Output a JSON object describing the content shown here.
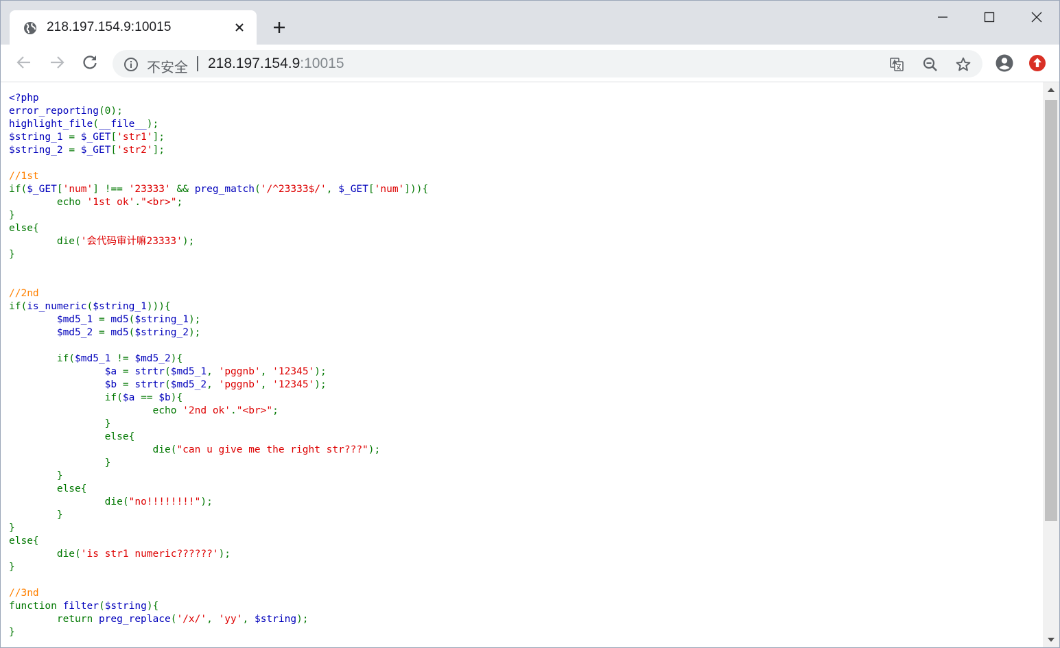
{
  "tab": {
    "title": "218.197.154.9:10015"
  },
  "omnibox": {
    "security_label": "不安全",
    "url_host": "218.197.154.9",
    "url_port": ":10015"
  },
  "icons": {
    "tab_favicon": "globe-icon",
    "tab_close": "close-icon",
    "new_tab": "plus-icon",
    "back": "back-arrow-icon",
    "forward": "forward-arrow-icon",
    "reload": "reload-icon",
    "site_info": "info-icon",
    "translate": "translate-icon",
    "zoom": "zoom-out-icon",
    "bookmark": "star-icon",
    "profile": "account-icon",
    "update": "update-icon"
  },
  "colors": {
    "php_default": "#0000bb",
    "php_keyword": "#007700",
    "php_string": "#dd0000",
    "php_comment": "#ff8000",
    "update_badge": "#d93025"
  },
  "code_lines": [
    [
      [
        "d",
        "<?php"
      ]
    ],
    [
      [
        "d",
        "error_reporting"
      ],
      [
        "k",
        "(0);"
      ]
    ],
    [
      [
        "d",
        "highlight_file"
      ],
      [
        "k",
        "("
      ],
      [
        "d",
        "__file__"
      ],
      [
        "k",
        ");"
      ]
    ],
    [
      [
        "d",
        "$string_1 "
      ],
      [
        "k",
        "= "
      ],
      [
        "d",
        "$_GET"
      ],
      [
        "k",
        "["
      ],
      [
        "s",
        "'str1'"
      ],
      [
        "k",
        "];"
      ]
    ],
    [
      [
        "d",
        "$string_2 "
      ],
      [
        "k",
        "= "
      ],
      [
        "d",
        "$_GET"
      ],
      [
        "k",
        "["
      ],
      [
        "s",
        "'str2'"
      ],
      [
        "k",
        "];"
      ]
    ],
    [],
    [
      [
        "c",
        "//1st"
      ]
    ],
    [
      [
        "k",
        "if("
      ],
      [
        "d",
        "$_GET"
      ],
      [
        "k",
        "["
      ],
      [
        "s",
        "'num'"
      ],
      [
        "k",
        "] !== "
      ],
      [
        "s",
        "'23333' "
      ],
      [
        "k",
        "&& "
      ],
      [
        "d",
        "preg_match"
      ],
      [
        "k",
        "("
      ],
      [
        "s",
        "'/^23333$/'"
      ],
      [
        "k",
        ", "
      ],
      [
        "d",
        "$_GET"
      ],
      [
        "k",
        "["
      ],
      [
        "s",
        "'num'"
      ],
      [
        "k",
        "])){"
      ]
    ],
    [
      [
        "k",
        "        echo "
      ],
      [
        "s",
        "'1st ok'"
      ],
      [
        "k",
        "."
      ],
      [
        "s",
        "\"<br>\""
      ],
      [
        "k",
        ";"
      ]
    ],
    [
      [
        "k",
        "}"
      ]
    ],
    [
      [
        "k",
        "else{"
      ]
    ],
    [
      [
        "k",
        "        die("
      ],
      [
        "s",
        "'会代码审计嘛23333'"
      ],
      [
        "k",
        ");"
      ]
    ],
    [
      [
        "k",
        "}"
      ]
    ],
    [],
    [],
    [
      [
        "c",
        "//2nd"
      ]
    ],
    [
      [
        "k",
        "if("
      ],
      [
        "d",
        "is_numeric"
      ],
      [
        "k",
        "("
      ],
      [
        "d",
        "$string_1"
      ],
      [
        "k",
        "))){"
      ]
    ],
    [
      [
        "d",
        "        $md5_1 "
      ],
      [
        "k",
        "= "
      ],
      [
        "d",
        "md5"
      ],
      [
        "k",
        "("
      ],
      [
        "d",
        "$string_1"
      ],
      [
        "k",
        ");"
      ]
    ],
    [
      [
        "d",
        "        $md5_2 "
      ],
      [
        "k",
        "= "
      ],
      [
        "d",
        "md5"
      ],
      [
        "k",
        "("
      ],
      [
        "d",
        "$string_2"
      ],
      [
        "k",
        ");"
      ]
    ],
    [],
    [
      [
        "k",
        "        if("
      ],
      [
        "d",
        "$md5_1 "
      ],
      [
        "k",
        "!= "
      ],
      [
        "d",
        "$md5_2"
      ],
      [
        "k",
        "){"
      ]
    ],
    [
      [
        "d",
        "                $a "
      ],
      [
        "k",
        "= "
      ],
      [
        "d",
        "strtr"
      ],
      [
        "k",
        "("
      ],
      [
        "d",
        "$md5_1"
      ],
      [
        "k",
        ", "
      ],
      [
        "s",
        "'pggnb'"
      ],
      [
        "k",
        ", "
      ],
      [
        "s",
        "'12345'"
      ],
      [
        "k",
        ");"
      ]
    ],
    [
      [
        "d",
        "                $b "
      ],
      [
        "k",
        "= "
      ],
      [
        "d",
        "strtr"
      ],
      [
        "k",
        "("
      ],
      [
        "d",
        "$md5_2"
      ],
      [
        "k",
        ", "
      ],
      [
        "s",
        "'pggnb'"
      ],
      [
        "k",
        ", "
      ],
      [
        "s",
        "'12345'"
      ],
      [
        "k",
        ");"
      ]
    ],
    [
      [
        "k",
        "                if("
      ],
      [
        "d",
        "$a "
      ],
      [
        "k",
        "== "
      ],
      [
        "d",
        "$b"
      ],
      [
        "k",
        "){"
      ]
    ],
    [
      [
        "k",
        "                        echo "
      ],
      [
        "s",
        "'2nd ok'"
      ],
      [
        "k",
        "."
      ],
      [
        "s",
        "\"<br>\""
      ],
      [
        "k",
        ";"
      ]
    ],
    [
      [
        "k",
        "                }"
      ]
    ],
    [
      [
        "k",
        "                else{"
      ]
    ],
    [
      [
        "k",
        "                        die("
      ],
      [
        "s",
        "\"can u give me the right str???\""
      ],
      [
        "k",
        ");"
      ]
    ],
    [
      [
        "k",
        "                }"
      ]
    ],
    [
      [
        "k",
        "        }"
      ]
    ],
    [
      [
        "k",
        "        else{"
      ]
    ],
    [
      [
        "k",
        "                die("
      ],
      [
        "s",
        "\"no!!!!!!!!\""
      ],
      [
        "k",
        ");"
      ]
    ],
    [
      [
        "k",
        "        }"
      ]
    ],
    [
      [
        "k",
        "}"
      ]
    ],
    [
      [
        "k",
        "else{"
      ]
    ],
    [
      [
        "k",
        "        die("
      ],
      [
        "s",
        "'is str1 numeric??????'"
      ],
      [
        "k",
        ");"
      ]
    ],
    [
      [
        "k",
        "}"
      ]
    ],
    [],
    [
      [
        "c",
        "//3nd"
      ]
    ],
    [
      [
        "k",
        "function "
      ],
      [
        "d",
        "filter"
      ],
      [
        "k",
        "("
      ],
      [
        "d",
        "$string"
      ],
      [
        "k",
        "){"
      ]
    ],
    [
      [
        "k",
        "        return "
      ],
      [
        "d",
        "preg_replace"
      ],
      [
        "k",
        "("
      ],
      [
        "s",
        "'/x/'"
      ],
      [
        "k",
        ", "
      ],
      [
        "s",
        "'yy'"
      ],
      [
        "k",
        ", "
      ],
      [
        "d",
        "$string"
      ],
      [
        "k",
        ");"
      ]
    ],
    [
      [
        "k",
        "}"
      ]
    ]
  ]
}
